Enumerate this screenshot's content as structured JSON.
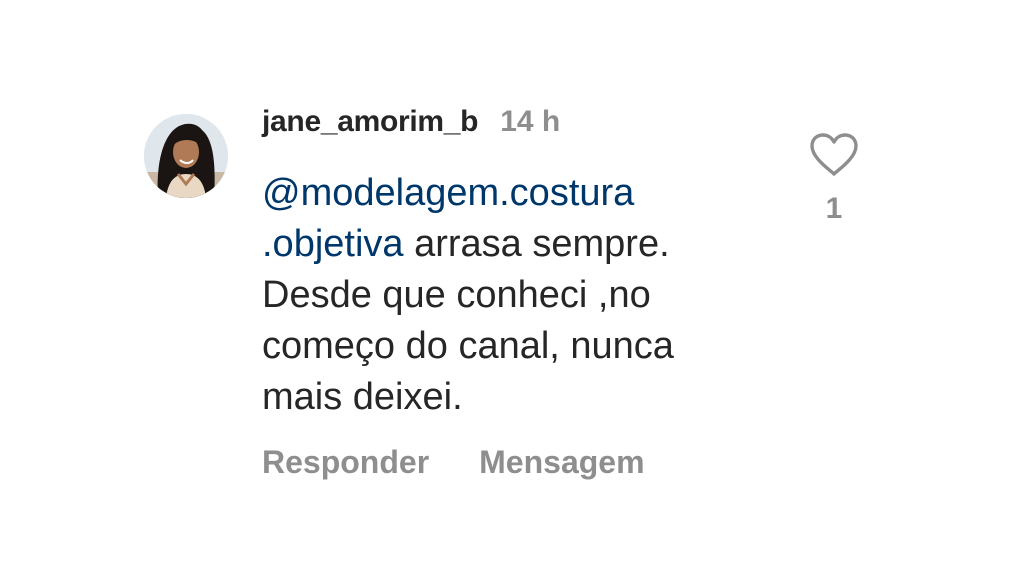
{
  "comment": {
    "username": "jane_amorim_b",
    "time": "14 h",
    "mention_line1": "@modelagem.costura",
    "mention_line2": ".objetiva",
    "text_line2_rest": " arrasa sempre.",
    "text_line3": "Desde que conheci ,no",
    "text_line4": "começo do canal, nunca",
    "text_line5": "mais deixei.",
    "reply_label": "Responder",
    "message_label": "Mensagem",
    "like_count": "1"
  },
  "icons": {
    "like": "heart-outline-icon",
    "avatar": "profile-photo"
  },
  "colors": {
    "text": "#262626",
    "secondary": "#8e8e8e",
    "mention": "#00376b",
    "background": "#ffffff"
  }
}
